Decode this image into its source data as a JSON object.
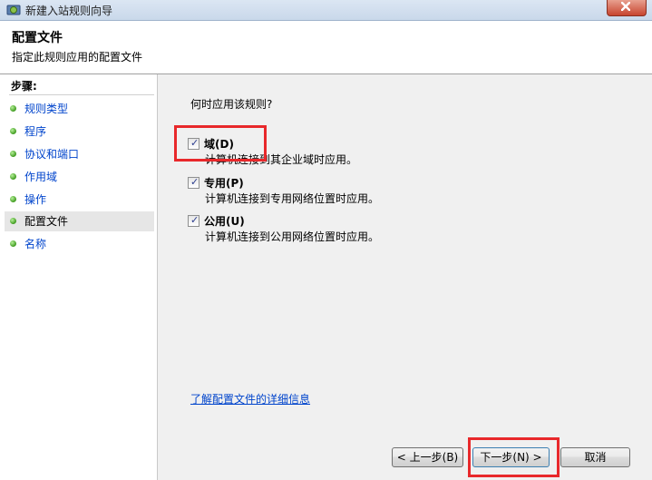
{
  "window": {
    "title": "新建入站规则向导"
  },
  "header": {
    "title": "配置文件",
    "subtitle": "指定此规则应用的配置文件"
  },
  "steps": {
    "label": "步骤:",
    "items": [
      {
        "label": "规则类型"
      },
      {
        "label": "程序"
      },
      {
        "label": "协议和端口"
      },
      {
        "label": "作用域"
      },
      {
        "label": "操作"
      },
      {
        "label": "配置文件"
      },
      {
        "label": "名称"
      }
    ],
    "active_index": 5
  },
  "main": {
    "question": "何时应用该规则?",
    "options": [
      {
        "label": "域(D)",
        "description": "计算机连接到其企业域时应用。",
        "checked": true
      },
      {
        "label": "专用(P)",
        "description": "计算机连接到专用网络位置时应用。",
        "checked": true
      },
      {
        "label": "公用(U)",
        "description": "计算机连接到公用网络位置时应用。",
        "checked": true
      }
    ],
    "more_link": "了解配置文件的详细信息"
  },
  "buttons": {
    "back": "< 上一步(B)",
    "next": "下一步(N) >",
    "cancel": "取消"
  },
  "colors": {
    "highlight_box": "#e8282b",
    "link": "#0044cc"
  }
}
